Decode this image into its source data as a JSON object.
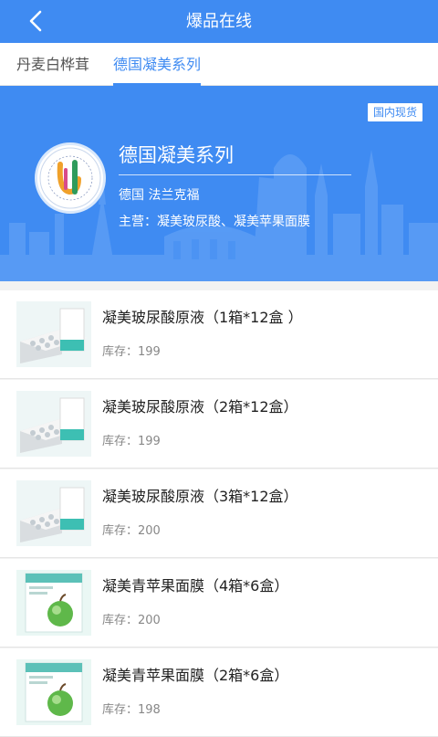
{
  "header": {
    "title": "爆品在线",
    "back_icon": "chevron-left-icon"
  },
  "tabs": [
    {
      "label": "丹麦白桦茸",
      "active": false
    },
    {
      "label": "德国凝美系列",
      "active": true
    }
  ],
  "banner": {
    "badge": "国内现货",
    "brand_name": "德国凝美系列",
    "origin": "德国 法兰克福",
    "main_business": "主营：凝美玻尿酸、凝美苹果面膜",
    "logo_letter": "U",
    "logo_ring_text": "UTL (HK) LTD.",
    "accent_color": "#3f8bf2"
  },
  "products": [
    {
      "name": "凝美玻尿酸原液（1箱*12盒 ）",
      "stock": "库存：199",
      "image": "serum-box"
    },
    {
      "name": "凝美玻尿酸原液（2箱*12盒）",
      "stock": "库存：199",
      "image": "serum-box"
    },
    {
      "name": "凝美玻尿酸原液（3箱*12盒）",
      "stock": "库存：200",
      "image": "serum-box"
    },
    {
      "name": "凝美青苹果面膜（4箱*6盒）",
      "stock": "库存：200",
      "image": "apple-mask-box"
    },
    {
      "name": "凝美青苹果面膜（2箱*6盒）",
      "stock": "库存：198",
      "image": "apple-mask-box"
    }
  ]
}
